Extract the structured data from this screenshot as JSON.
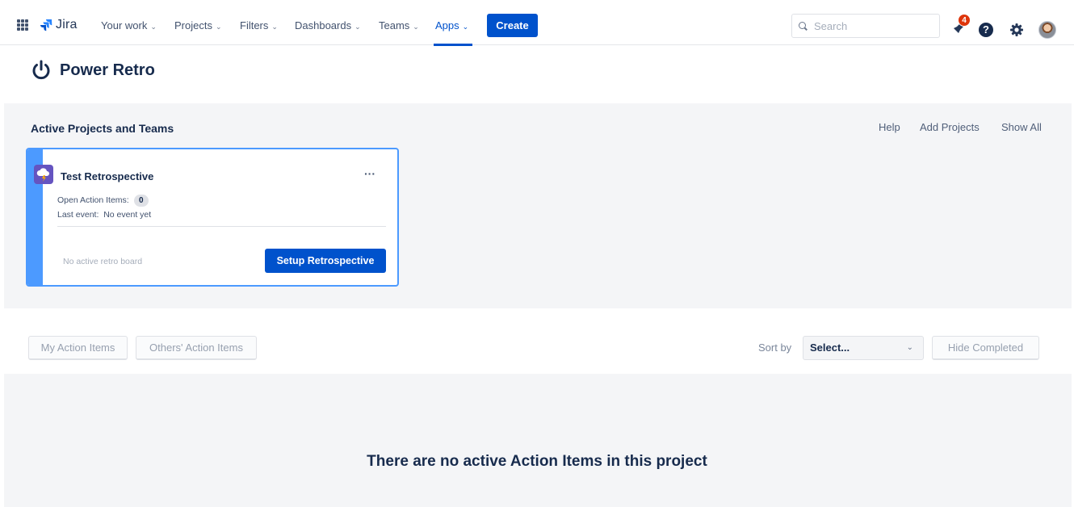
{
  "topnav": {
    "product": "Jira",
    "items": [
      {
        "label": "Your work"
      },
      {
        "label": "Projects"
      },
      {
        "label": "Filters"
      },
      {
        "label": "Dashboards"
      },
      {
        "label": "Teams"
      },
      {
        "label": "Apps",
        "active": true
      }
    ],
    "create_label": "Create",
    "search_placeholder": "Search",
    "notification_count": "4",
    "help_glyph": "?"
  },
  "app": {
    "title": "Power Retro",
    "icon": "power-icon"
  },
  "projects": {
    "section_title": "Active Projects and Teams",
    "links": [
      "Help",
      "Add Projects",
      "Show All"
    ],
    "cards": [
      {
        "title": "Test Retrospective",
        "more_label": "···",
        "open_action_items_label": "Open Action Items:",
        "open_action_items_count": "0",
        "last_event_label": "Last event:",
        "last_event_value": "No event yet",
        "footer_status": "No active retro board",
        "setup_label": "Setup Retrospective"
      }
    ]
  },
  "action_items": {
    "tabs": [
      "My Action Items",
      "Others' Action Items"
    ],
    "sort_label": "Sort by",
    "sort_value": "Select...",
    "hide_completed_label": "Hide Completed",
    "empty_message": "There are no active Action Items in this project"
  },
  "colors": {
    "brand": "#0052cc",
    "card_accent": "#4c9aff",
    "badge": "#de350b",
    "band_bg": "#f4f5f7"
  }
}
